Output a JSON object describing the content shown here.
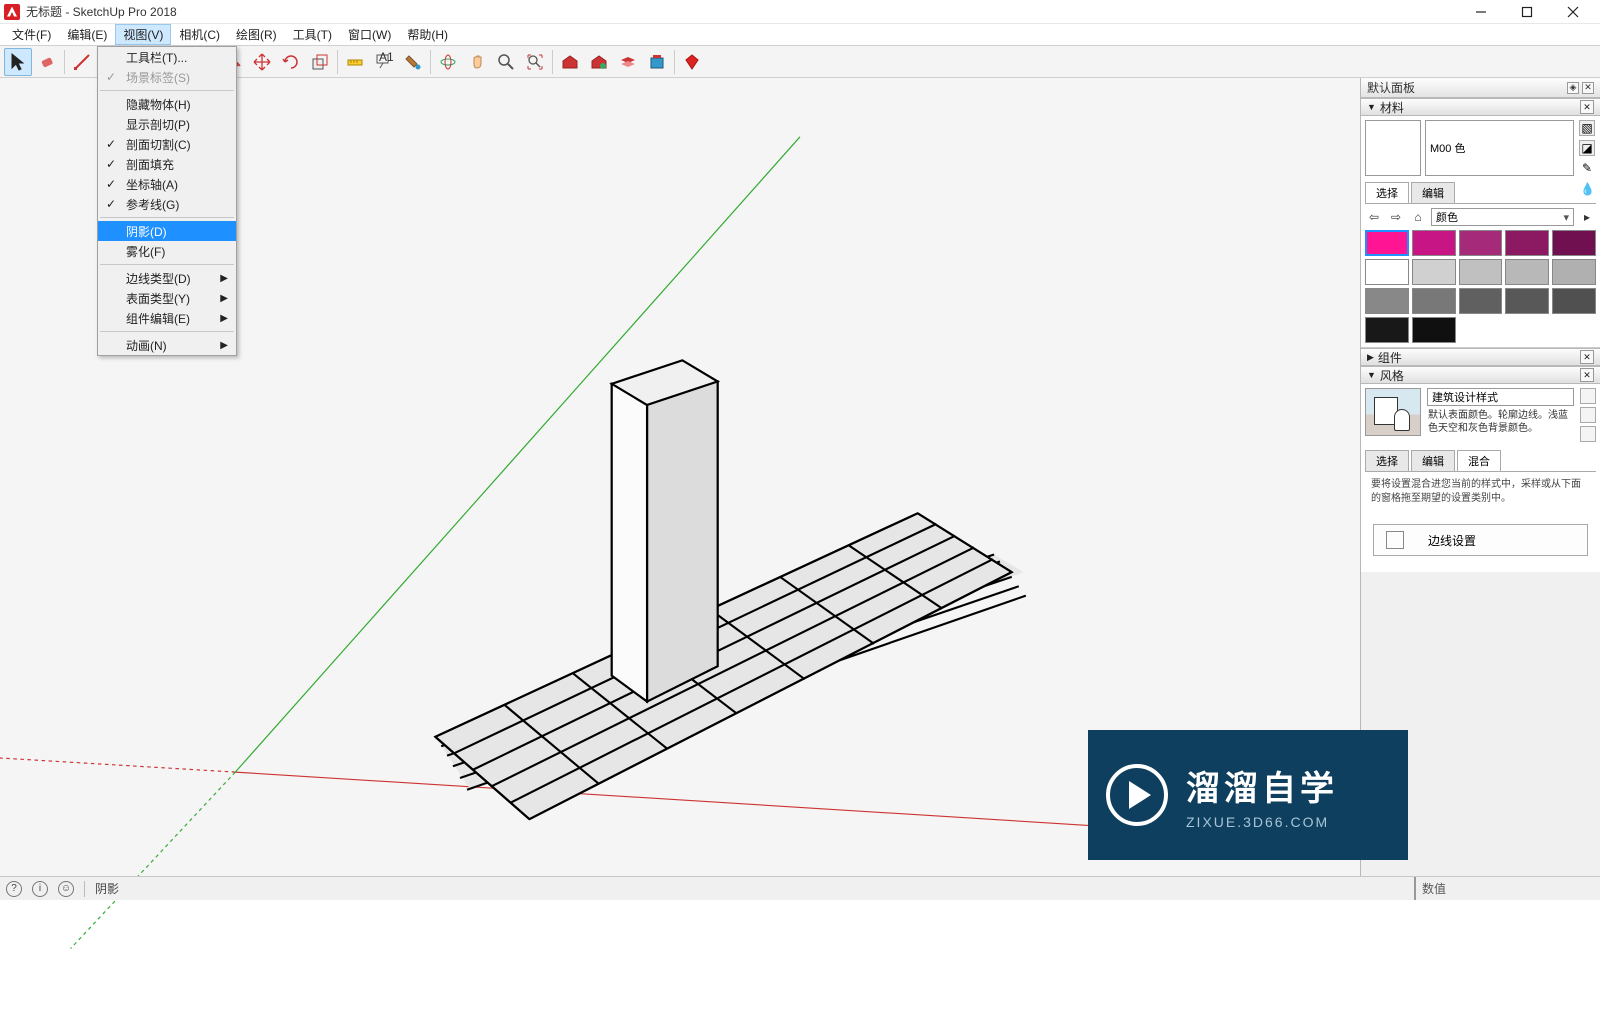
{
  "app": {
    "title": "无标题 - SketchUp Pro 2018"
  },
  "menus": {
    "items": [
      "文件(F)",
      "编辑(E)",
      "视图(V)",
      "相机(C)",
      "绘图(R)",
      "工具(T)",
      "窗口(W)",
      "帮助(H)"
    ],
    "openIndex": 2
  },
  "dropdown": {
    "items": [
      {
        "label": "工具栏(T)...",
        "checked": false,
        "sub": false
      },
      {
        "label": "场景标签(S)",
        "checked": true,
        "sub": false,
        "disabled": true
      },
      {
        "sep": true
      },
      {
        "label": "隐藏物体(H)",
        "checked": false,
        "sub": false
      },
      {
        "label": "显示剖切(P)",
        "checked": false,
        "sub": false
      },
      {
        "label": "剖面切割(C)",
        "checked": true,
        "sub": false
      },
      {
        "label": "剖面填充",
        "checked": true,
        "sub": false
      },
      {
        "label": "坐标轴(A)",
        "checked": true,
        "sub": false
      },
      {
        "label": "参考线(G)",
        "checked": true,
        "sub": false
      },
      {
        "sep": true
      },
      {
        "label": "阴影(D)",
        "checked": false,
        "sub": false,
        "highlight": true
      },
      {
        "label": "雾化(F)",
        "checked": false,
        "sub": false
      },
      {
        "sep": true
      },
      {
        "label": "边线类型(D)",
        "checked": false,
        "sub": true
      },
      {
        "label": "表面类型(Y)",
        "checked": false,
        "sub": true
      },
      {
        "label": "组件编辑(E)",
        "checked": false,
        "sub": true
      },
      {
        "sep": true
      },
      {
        "label": "动画(N)",
        "checked": false,
        "sub": true
      }
    ]
  },
  "panel": {
    "title": "默认面板",
    "materials": {
      "header": "材料",
      "name": "M00 色",
      "tabs": [
        "选择",
        "编辑"
      ],
      "dropdown": "颜色",
      "swatches": [
        {
          "c": "#ff1493",
          "sel": true
        },
        {
          "c": "#c71585"
        },
        {
          "c": "#a52a7a"
        },
        {
          "c": "#8b1a62"
        },
        {
          "c": "#701050"
        },
        {
          "c": "#ffffff"
        },
        {
          "c": "#d0d0d0"
        },
        {
          "c": "#c0c0c0"
        },
        {
          "c": "#b8b8b8"
        },
        {
          "c": "#b0b0b0"
        },
        {
          "c": "#888888"
        },
        {
          "c": "#787878"
        },
        {
          "c": "#606060"
        },
        {
          "c": "#585858"
        },
        {
          "c": "#505050"
        },
        {
          "c": "#181818"
        },
        {
          "c": "#101010"
        }
      ]
    },
    "components": {
      "header": "组件"
    },
    "styles": {
      "header": "风格",
      "name": "建筑设计样式",
      "desc": "默认表面颜色。轮廓边线。浅蓝色天空和灰色背景颜色。",
      "tabs": [
        "选择",
        "编辑",
        "混合"
      ],
      "mixText": "要将设置混合进您当前的样式中，采样或从下面的窗格拖至期望的设置类别中。",
      "edgeBtn": "边线设置"
    }
  },
  "toolbar": {
    "names": [
      "select-tool",
      "eraser-tool",
      "line-tool",
      "arc-tool",
      "rectangle-tool",
      "circle-tool",
      "pushpull-tool",
      "offset-tool",
      "move-tool",
      "rotate-tool",
      "scale-tool",
      "tape-tool",
      "text-tool",
      "paint-tool",
      "orbit-tool",
      "pan-tool",
      "zoom-tool",
      "zoom-extents-tool",
      "warehouse-tool",
      "warehouse2-tool",
      "layers-tool",
      "extension-tool",
      "ruby-tool"
    ]
  },
  "status": {
    "hint": "阴影",
    "valueLabel": "数值"
  },
  "watermark": {
    "line1": "溜溜自学",
    "line2": "ZIXUE.3D66.COM"
  }
}
